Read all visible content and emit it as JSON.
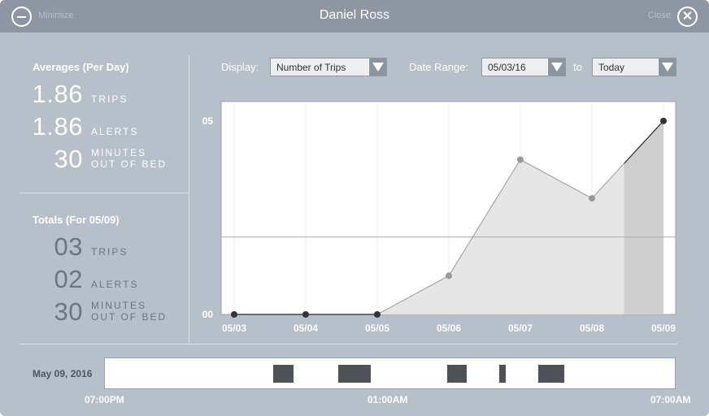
{
  "window": {
    "title": "Daniel Ross",
    "minimize_label": "Minimize",
    "close_label": "Close",
    "close_glyph": "✕"
  },
  "averages": {
    "heading": "Averages (Per Day)",
    "trips": {
      "value": "1.86",
      "label": "TRIPS"
    },
    "alerts": {
      "value": "1.86",
      "label": "ALERTS"
    },
    "minutes": {
      "value": "30",
      "label_line1": "MINUTES",
      "label_line2": "OUT OF BED"
    }
  },
  "totals": {
    "heading": "Totals (For 05/09)",
    "trips": {
      "value": "03",
      "label": "TRIPS"
    },
    "alerts": {
      "value": "02",
      "label": "ALERTS"
    },
    "minutes": {
      "value": "30",
      "label_line1": "MINUTES",
      "label_line2": "OUT OF BED"
    }
  },
  "controls": {
    "display_label": "Display:",
    "display_value": "Number of Trips",
    "range_label": "Date Range:",
    "range_start": "05/03/16",
    "to_label": "to",
    "range_end": "Today"
  },
  "chart_data": {
    "type": "area",
    "categories": [
      "05/03",
      "05/04",
      "05/05",
      "05/06",
      "05/07",
      "05/08",
      "05/09"
    ],
    "values": [
      0,
      0,
      0,
      1,
      4,
      3,
      5
    ],
    "y_tick_labels": [
      "00",
      "05"
    ],
    "ylim": [
      0,
      5.5
    ],
    "reference_line": 2,
    "highlight_color": "#cfcfcf",
    "fill_color": "#e6e6e6",
    "line_color": "#9a9a9a"
  },
  "timeline": {
    "date_label": "May 09, 2016",
    "tick_labels": [
      "07:00PM",
      "01:00AM",
      "07:00AM"
    ],
    "events": [
      {
        "start": 0.295,
        "end": 0.331
      },
      {
        "start": 0.409,
        "end": 0.467
      },
      {
        "start": 0.601,
        "end": 0.635
      },
      {
        "start": 0.692,
        "end": 0.704
      },
      {
        "start": 0.761,
        "end": 0.806
      }
    ]
  }
}
